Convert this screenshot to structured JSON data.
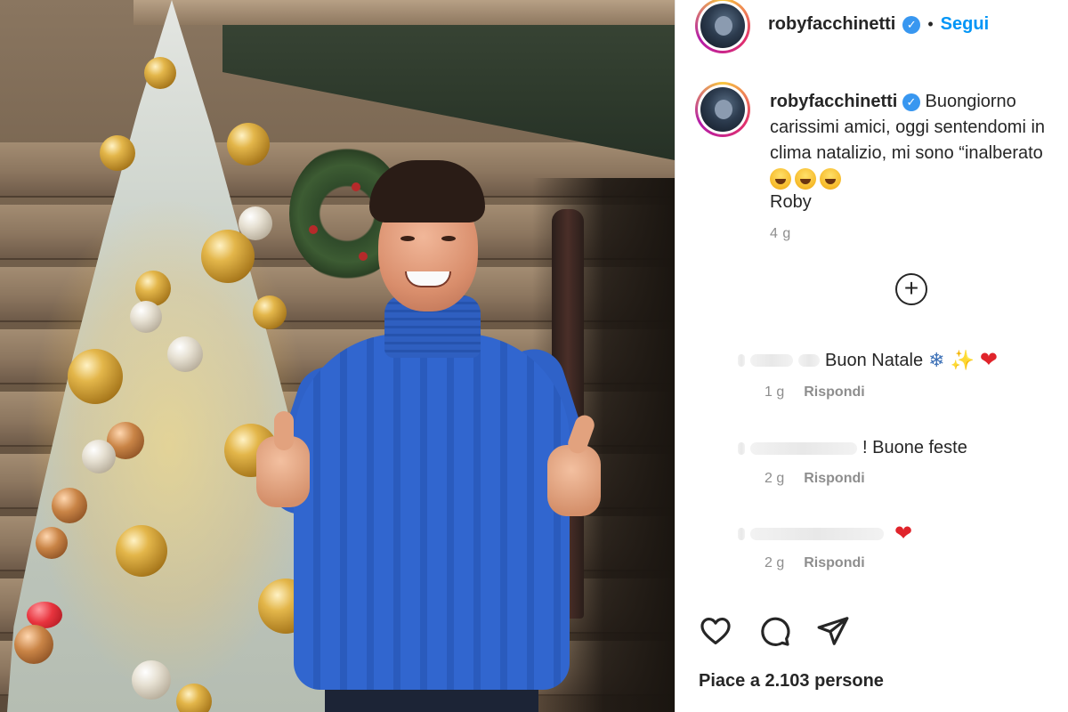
{
  "header": {
    "username": "robyfacchinetti",
    "separator": "•",
    "follow_label": "Segui"
  },
  "caption": {
    "username": "robyfacchinetti",
    "line1": "Buongiorno",
    "line2": "carissimi amici, oggi sentendomi in",
    "line3": "clima natalizio, mi sono “inalberato",
    "sign": "Roby",
    "time": "4 g"
  },
  "comments": [
    {
      "text": "Buon Natale",
      "time": "1 g",
      "reply_label": "Rispondi"
    },
    {
      "text": "! Buone feste",
      "time": "2 g",
      "reply_label": "Rispondi"
    },
    {
      "text": "",
      "time": "2 g",
      "reply_label": "Rispondi"
    }
  ],
  "add_comment_symbol": "+",
  "likes_text": "Piace a 2.103 persone",
  "icons": {
    "like": "heart-icon",
    "comment": "comment-icon",
    "share": "share-icon",
    "verified": "verified-badge-icon",
    "add": "plus-circle-icon"
  },
  "colors": {
    "follow": "#0095f6",
    "verified": "#3897f0",
    "meta": "#8e8e8e",
    "text": "#262626"
  }
}
